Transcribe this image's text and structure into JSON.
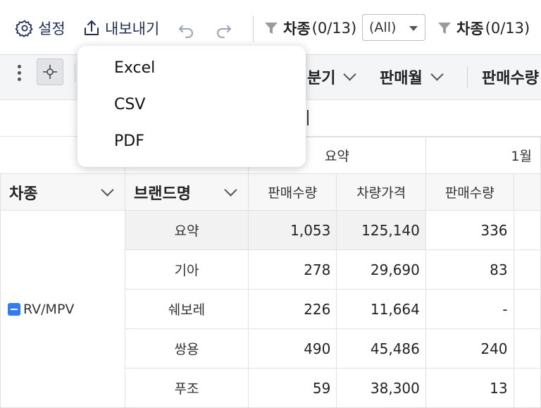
{
  "toolbar": {
    "settings_label": "설정",
    "export_label": "내보내기",
    "filter1_name": "차종",
    "filter1_count": "(0/13)",
    "filter1_select": "(All)",
    "filter2_name": "차종",
    "filter2_count": "(0/13)"
  },
  "export_menu": {
    "items": [
      "Excel",
      "CSV",
      "PDF"
    ]
  },
  "pivot_bar": {
    "fields": [
      "분기",
      "판매월",
      "판매수량"
    ]
  },
  "grid": {
    "column_fields": [
      "차종",
      "브랜드명"
    ],
    "group_headers": [
      "요약",
      "1월"
    ],
    "measure_headers": [
      "판매수량",
      "차량가격",
      "판매수량"
    ],
    "row_group": "RV/MPV",
    "rows": [
      {
        "brand": "요약",
        "qty": "1,053",
        "price": "125,140",
        "jan_qty": "336"
      },
      {
        "brand": "기아",
        "qty": "278",
        "price": "29,690",
        "jan_qty": "83"
      },
      {
        "brand": "쉐보레",
        "qty": "226",
        "price": "11,664",
        "jan_qty": "-"
      },
      {
        "brand": "쌍용",
        "qty": "490",
        "price": "45,486",
        "jan_qty": "240"
      },
      {
        "brand": "푸조",
        "qty": "59",
        "price": "38,300",
        "jan_qty": "13"
      }
    ]
  },
  "colors": {
    "toolbar_text": "#1f2d5a",
    "accent": "#2f7cf6"
  }
}
